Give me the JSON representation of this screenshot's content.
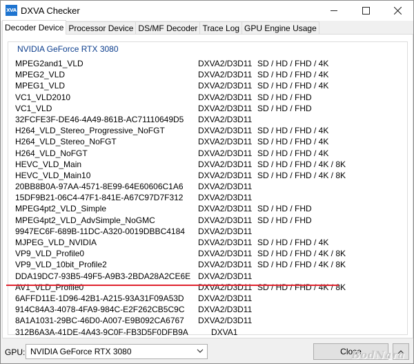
{
  "window": {
    "title": "DXVA Checker",
    "icon_text": "XVA"
  },
  "tabs": [
    {
      "label": "Decoder Device",
      "active": true
    },
    {
      "label": "Processor Device",
      "active": false
    },
    {
      "label": "DS/MF Decoder",
      "active": false
    },
    {
      "label": "Trace Log",
      "active": false
    },
    {
      "label": "GPU Engine Usage",
      "active": false
    }
  ],
  "group": {
    "title": "NVIDIA GeForce RTX 3080"
  },
  "decoders": [
    {
      "name": "MPEG2and1_VLD",
      "api": "DXVA2/D3D11",
      "res": "SD / HD / FHD / 4K"
    },
    {
      "name": "MPEG2_VLD",
      "api": "DXVA2/D3D11",
      "res": "SD / HD / FHD / 4K"
    },
    {
      "name": "MPEG1_VLD",
      "api": "DXVA2/D3D11",
      "res": "SD / HD / FHD / 4K"
    },
    {
      "name": "VC1_VLD2010",
      "api": "DXVA2/D3D11",
      "res": "SD / HD / FHD"
    },
    {
      "name": "VC1_VLD",
      "api": "DXVA2/D3D11",
      "res": "SD / HD / FHD"
    },
    {
      "name": "32FCFE3F-DE46-4A49-861B-AC71110649D5",
      "api": "DXVA2/D3D11",
      "res": ""
    },
    {
      "name": "H264_VLD_Stereo_Progressive_NoFGT",
      "api": "DXVA2/D3D11",
      "res": "SD / HD / FHD / 4K"
    },
    {
      "name": "H264_VLD_Stereo_NoFGT",
      "api": "DXVA2/D3D11",
      "res": "SD / HD / FHD / 4K"
    },
    {
      "name": "H264_VLD_NoFGT",
      "api": "DXVA2/D3D11",
      "res": "SD / HD / FHD / 4K"
    },
    {
      "name": "HEVC_VLD_Main",
      "api": "DXVA2/D3D11",
      "res": "SD / HD / FHD / 4K / 8K"
    },
    {
      "name": "HEVC_VLD_Main10",
      "api": "DXVA2/D3D11",
      "res": "SD / HD / FHD / 4K / 8K"
    },
    {
      "name": "20BB8B0A-97AA-4571-8E99-64E60606C1A6",
      "api": "DXVA2/D3D11",
      "res": ""
    },
    {
      "name": "15DF9B21-06C4-47F1-841E-A67C97D7F312",
      "api": "DXVA2/D3D11",
      "res": ""
    },
    {
      "name": "MPEG4pt2_VLD_Simple",
      "api": "DXVA2/D3D11",
      "res": "SD / HD / FHD"
    },
    {
      "name": "MPEG4pt2_VLD_AdvSimple_NoGMC",
      "api": "DXVA2/D3D11",
      "res": "SD / HD / FHD"
    },
    {
      "name": "9947EC6F-689B-11DC-A320-0019DBBC4184",
      "api": "DXVA2/D3D11",
      "res": ""
    },
    {
      "name": "MJPEG_VLD_NVIDIA",
      "api": "DXVA2/D3D11",
      "res": "SD / HD / FHD / 4K"
    },
    {
      "name": "VP9_VLD_Profile0",
      "api": "DXVA2/D3D11",
      "res": "SD / HD / FHD / 4K / 8K"
    },
    {
      "name": "VP9_VLD_10bit_Profile2",
      "api": "DXVA2/D3D11",
      "res": "SD / HD / FHD / 4K / 8K"
    },
    {
      "name": "DDA19DC7-93B5-49F5-A9B3-2BDA28A2CE6E",
      "api": "DXVA2/D3D11",
      "res": ""
    },
    {
      "name": "AV1_VLD_Profile0",
      "api": "DXVA2/D3D11",
      "res": "SD / HD / FHD / 4K / 8K"
    },
    {
      "name": "6AFFD11E-1D96-42B1-A215-93A31F09A53D",
      "api": "DXVA2/D3D11",
      "res": ""
    },
    {
      "name": "914C84A3-4078-4FA9-984C-E2F262CB5C9C",
      "api": "DXVA2/D3D11",
      "res": ""
    },
    {
      "name": "8A1A1031-29BC-46D0-A007-E9B092CA6767",
      "api": "DXVA2/D3D11",
      "res": ""
    },
    {
      "name": "312B6A3A-41DE-4A43-9C0F-FB3D5F0DFB9A",
      "api": "DXVA1",
      "res": ""
    }
  ],
  "footer": {
    "gpu_label": "GPU:",
    "gpu_selected": "NVIDIA GeForce RTX 3080",
    "close_label": "Close"
  },
  "watermark": "BodNara",
  "colors": {
    "group_title": "#0a3c8c",
    "highlight": "#e0212c"
  }
}
